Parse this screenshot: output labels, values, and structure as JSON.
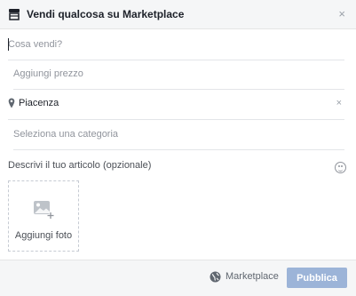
{
  "dialog": {
    "title": "Vendi qualcosa su Marketplace",
    "close_symbol": "×",
    "header_icon": "storefront-icon"
  },
  "form": {
    "title_placeholder": "Cosa vendi?",
    "price_placeholder": "Aggiungi prezzo",
    "location_value": "Piacenza",
    "location_clear_symbol": "×",
    "location_icon": "map-pin-icon",
    "category_placeholder": "Seleziona una categoria",
    "description_placeholder": "Descrivi il tuo articolo (opzionale)",
    "emoji_icon": "smiley-icon",
    "add_photo_label": "Aggiungi foto",
    "add_photo_icon": "photo-add-icon"
  },
  "footer": {
    "audience_icon": "globe-icon",
    "audience_label": "Marketplace",
    "publish_label": "Pubblica"
  },
  "colors": {
    "header_bg": "#f5f6f7",
    "publish_button_disabled": "#9cb4d8",
    "placeholder_text": "#90949c",
    "icon_gray": "#606770"
  }
}
